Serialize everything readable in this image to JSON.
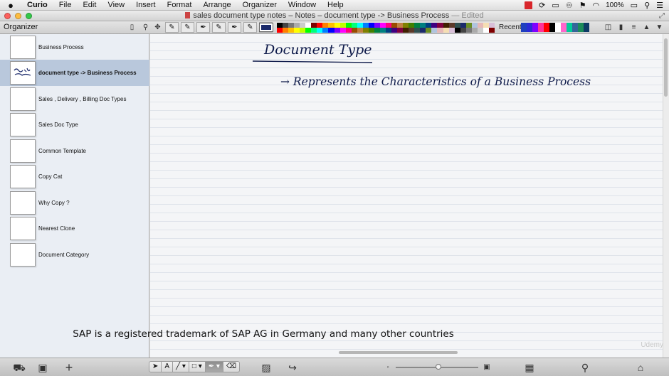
{
  "menubar": {
    "app_name": "Curio",
    "items": [
      "File",
      "Edit",
      "View",
      "Insert",
      "Format",
      "Arrange",
      "Organizer",
      "Window",
      "Help"
    ],
    "battery": "100%"
  },
  "window": {
    "title": "sales document type notes – Notes – document type -> Business Process",
    "status": "— Edited"
  },
  "toolbar": {
    "organizer_label": "Organizer",
    "recent_label": "Recent",
    "current_color": "#1b2a6b",
    "palette": [
      "#000000",
      "#444444",
      "#777777",
      "#aaaaaa",
      "#cccccc",
      "#ffffff",
      "#7f0000",
      "#ff0000",
      "#ff7f00",
      "#ffbf00",
      "#ffff00",
      "#bfff00",
      "#00ff00",
      "#00ff7f",
      "#00ffff",
      "#007fff",
      "#0000ff",
      "#7f00ff",
      "#ff00ff",
      "#ff007f",
      "#994c00",
      "#c08040",
      "#808000",
      "#408000",
      "#008040",
      "#008080",
      "#004080",
      "#400080",
      "#800040",
      "#402000",
      "#5b3a29",
      "#2f4f4f",
      "#1b2a6b",
      "#6b8e23",
      "#b0c4de",
      "#e6b8b7",
      "#f5deb3",
      "#d8bfd8"
    ],
    "recent_colors": [
      "#1f3fbf",
      "#2b2bd6",
      "#7f00ff",
      "#ff3399",
      "#ff0000",
      "#000000",
      "#ffffff",
      "#ff66cc",
      "#00cc99",
      "#336699",
      "#1b8c5a",
      "#0d3b66"
    ]
  },
  "sidebar": {
    "items": [
      {
        "label": "Business Process"
      },
      {
        "label": "document type -> Business Process",
        "selected": true
      },
      {
        "label": "Sales , Delivery , Billing Doc Types"
      },
      {
        "label": "Sales Doc Type"
      },
      {
        "label": "Common Template"
      },
      {
        "label": "Copy Cat"
      },
      {
        "label": "Why Copy ?"
      },
      {
        "label": "Nearest Clone"
      },
      {
        "label": "Document Category"
      }
    ]
  },
  "canvas": {
    "heading": "Document Type",
    "note_line": "→ Represents the Characteristics of a Business Process",
    "ink_color": "#0e1a4a"
  },
  "caption": "SAP is a registered trademark of SAP AG in Germany and many other countries",
  "watermark": "Udemy",
  "zoom_level": 0.52
}
